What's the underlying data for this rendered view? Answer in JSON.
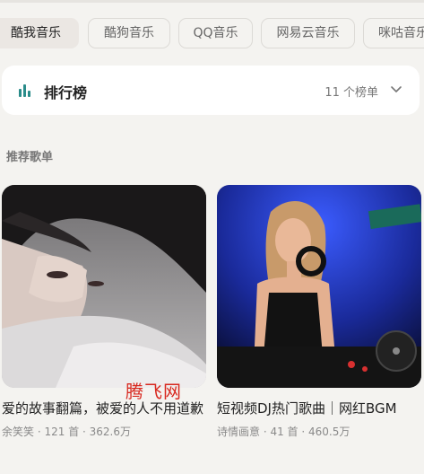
{
  "platform_tabs": [
    "酷我音乐",
    "酷狗音乐",
    "QQ音乐",
    "网易云音乐",
    "咪咕音乐"
  ],
  "rank": {
    "title": "排行榜",
    "count": "11 个榜单",
    "icon": "bar-chart-icon",
    "accent": "#2a8c8a"
  },
  "section_title": "推荐歌单",
  "playlists": [
    {
      "title": "爱的故事翻篇，被爱的人不用道歉",
      "author": "余笑笑",
      "tracks": "121 首",
      "plays": "362.6万"
    },
    {
      "title": "短视频DJ热门歌曲｜网红BGM",
      "author": "诗情画意",
      "tracks": "41 首",
      "plays": "460.5万"
    }
  ],
  "watermark": "腾飞网"
}
